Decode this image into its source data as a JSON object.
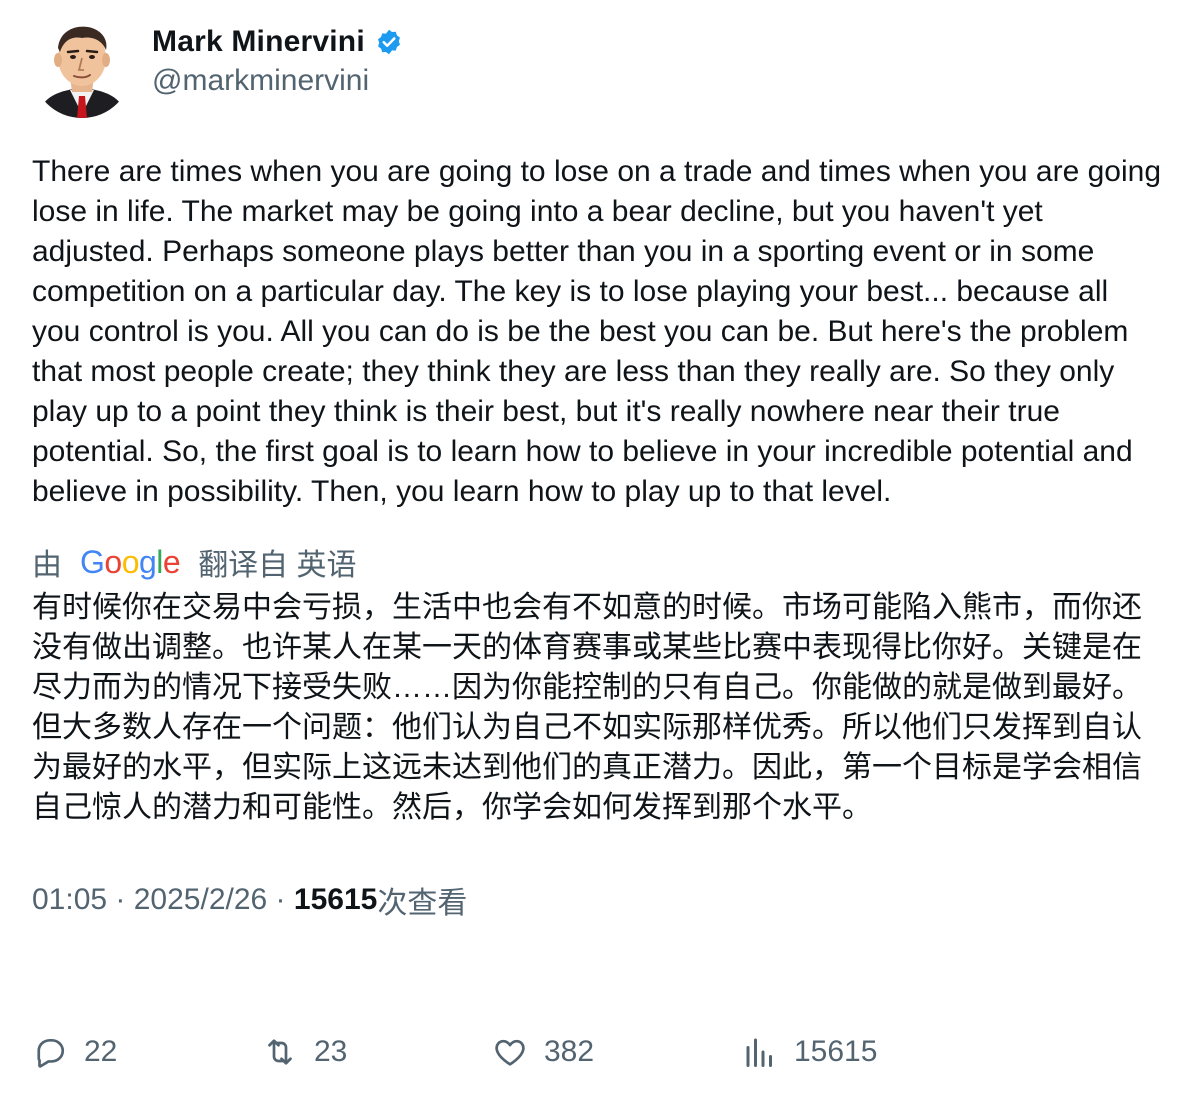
{
  "colors": {
    "text_primary": "#0f1419",
    "text_secondary": "#536471",
    "verified_blue": "#1d9bf0",
    "google_blue": "#4285F4",
    "google_red": "#EA4335",
    "google_yellow": "#FBBC05",
    "google_green": "#34A853"
  },
  "author": {
    "display_name": "Mark Minervini",
    "handle": "@markminervini",
    "verified_icon": "verified-badge-icon"
  },
  "tweet": {
    "text": "There are times when you are going to lose on a trade and times when you are going lose in life. The market may be going into a bear decline, but you haven't yet adjusted. Perhaps someone plays better than you in a sporting event or in some competition on a particular day. The key is to lose playing your best... because all you control is you. All you can do is be the best you can be. But here's the problem that most people create; they think they are less than they really are. So they only play up to a point they think is their best, but it's really nowhere near their true potential. So, the first goal is to learn how to believe in your incredible potential and believe in possibility. Then, you learn how to play up to that level.",
    "translation": {
      "prefix": "由",
      "provider": "Google",
      "suffix": "翻译自 英语",
      "text": "有时候你在交易中会亏损，生活中也会有不如意的时候。市场可能陷入熊市，而你还没有做出调整。也许某人在某一天的体育赛事或某些比赛中表现得比你好。关键是在尽力而为的情况下接受失败……因为你能控制的只有自己。你能做的就是做到最好。但大多数人存在一个问题：他们认为自己不如实际那样优秀。所以他们只发挥到自认为最好的水平，但实际上这远未达到他们的真正潜力。因此，第一个目标是学会相信自己惊人的潜力和可能性。然后，你学会如何发挥到那个水平。"
    },
    "meta": {
      "time": "01:05",
      "sep1": " · ",
      "date": "2025/2/26",
      "sep2": " · ",
      "views_count": "15615",
      "views_label": "次查看"
    }
  },
  "actions": {
    "reply": {
      "icon": "reply-icon",
      "count": "22"
    },
    "retweet": {
      "icon": "retweet-icon",
      "count": "23"
    },
    "like": {
      "icon": "heart-icon",
      "count": "382"
    },
    "views": {
      "icon": "analytics-icon",
      "count": "15615"
    }
  }
}
